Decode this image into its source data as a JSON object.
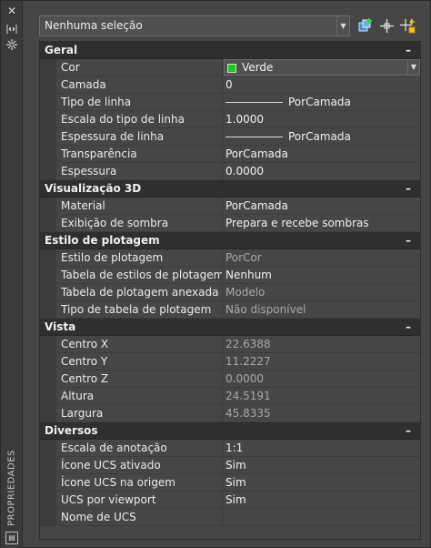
{
  "palette": {
    "title": "PROPRIEDADES",
    "close_icon": "close-icon",
    "autohide_icon": "autohide-icon",
    "settings_icon": "properties-settings-icon"
  },
  "selection": {
    "value": "Nenhuma seleção",
    "toolbar_icons": [
      "toggle-pickadd-icon",
      "select-objects-icon",
      "quick-select-icon"
    ]
  },
  "categories": [
    {
      "label": "Geral",
      "properties": [
        {
          "name": "Cor",
          "value": "Verde",
          "swatch": "#10d010",
          "dropdown": true
        },
        {
          "name": "Camada",
          "value": "0"
        },
        {
          "name": "Tipo de linha",
          "value": "PorCamada",
          "linesample": true
        },
        {
          "name": "Escala do tipo de linha",
          "value": "1.0000"
        },
        {
          "name": "Espessura de linha",
          "value": "PorCamada",
          "linesample": true
        },
        {
          "name": "Transparência",
          "value": "PorCamada"
        },
        {
          "name": "Espessura",
          "value": "0.0000"
        }
      ]
    },
    {
      "label": "Visualização 3D",
      "properties": [
        {
          "name": "Material",
          "value": "PorCamada"
        },
        {
          "name": "Exibição de sombra",
          "value": "Prepara e recebe sombras"
        }
      ]
    },
    {
      "label": "Estilo de plotagem",
      "properties": [
        {
          "name": "Estilo de plotagem",
          "value": "PorCor",
          "dim": true
        },
        {
          "name": "Tabela de estilos de plotagem",
          "value": "Nenhum"
        },
        {
          "name": "Tabela de plotagem anexada a",
          "value": "Modelo",
          "dim": true
        },
        {
          "name": "Tipo de tabela de plotagem",
          "value": "Não disponível",
          "dim": true
        }
      ]
    },
    {
      "label": "Vista",
      "properties": [
        {
          "name": "Centro X",
          "value": "22.6388",
          "dim": true
        },
        {
          "name": "Centro Y",
          "value": "11.2227",
          "dim": true
        },
        {
          "name": "Centro Z",
          "value": "0.0000",
          "dim": true
        },
        {
          "name": "Altura",
          "value": "24.5191",
          "dim": true
        },
        {
          "name": "Largura",
          "value": "45.8335",
          "dim": true
        }
      ]
    },
    {
      "label": "Diversos",
      "properties": [
        {
          "name": "Escala de anotação",
          "value": "1:1"
        },
        {
          "name": "Ícone UCS ativado",
          "value": "Sim"
        },
        {
          "name": "Ícone UCS na origem",
          "value": "Sim"
        },
        {
          "name": "UCS por viewport",
          "value": "Sim"
        },
        {
          "name": "Nome de UCS",
          "value": ""
        }
      ]
    }
  ],
  "collapse_symbol": "–"
}
